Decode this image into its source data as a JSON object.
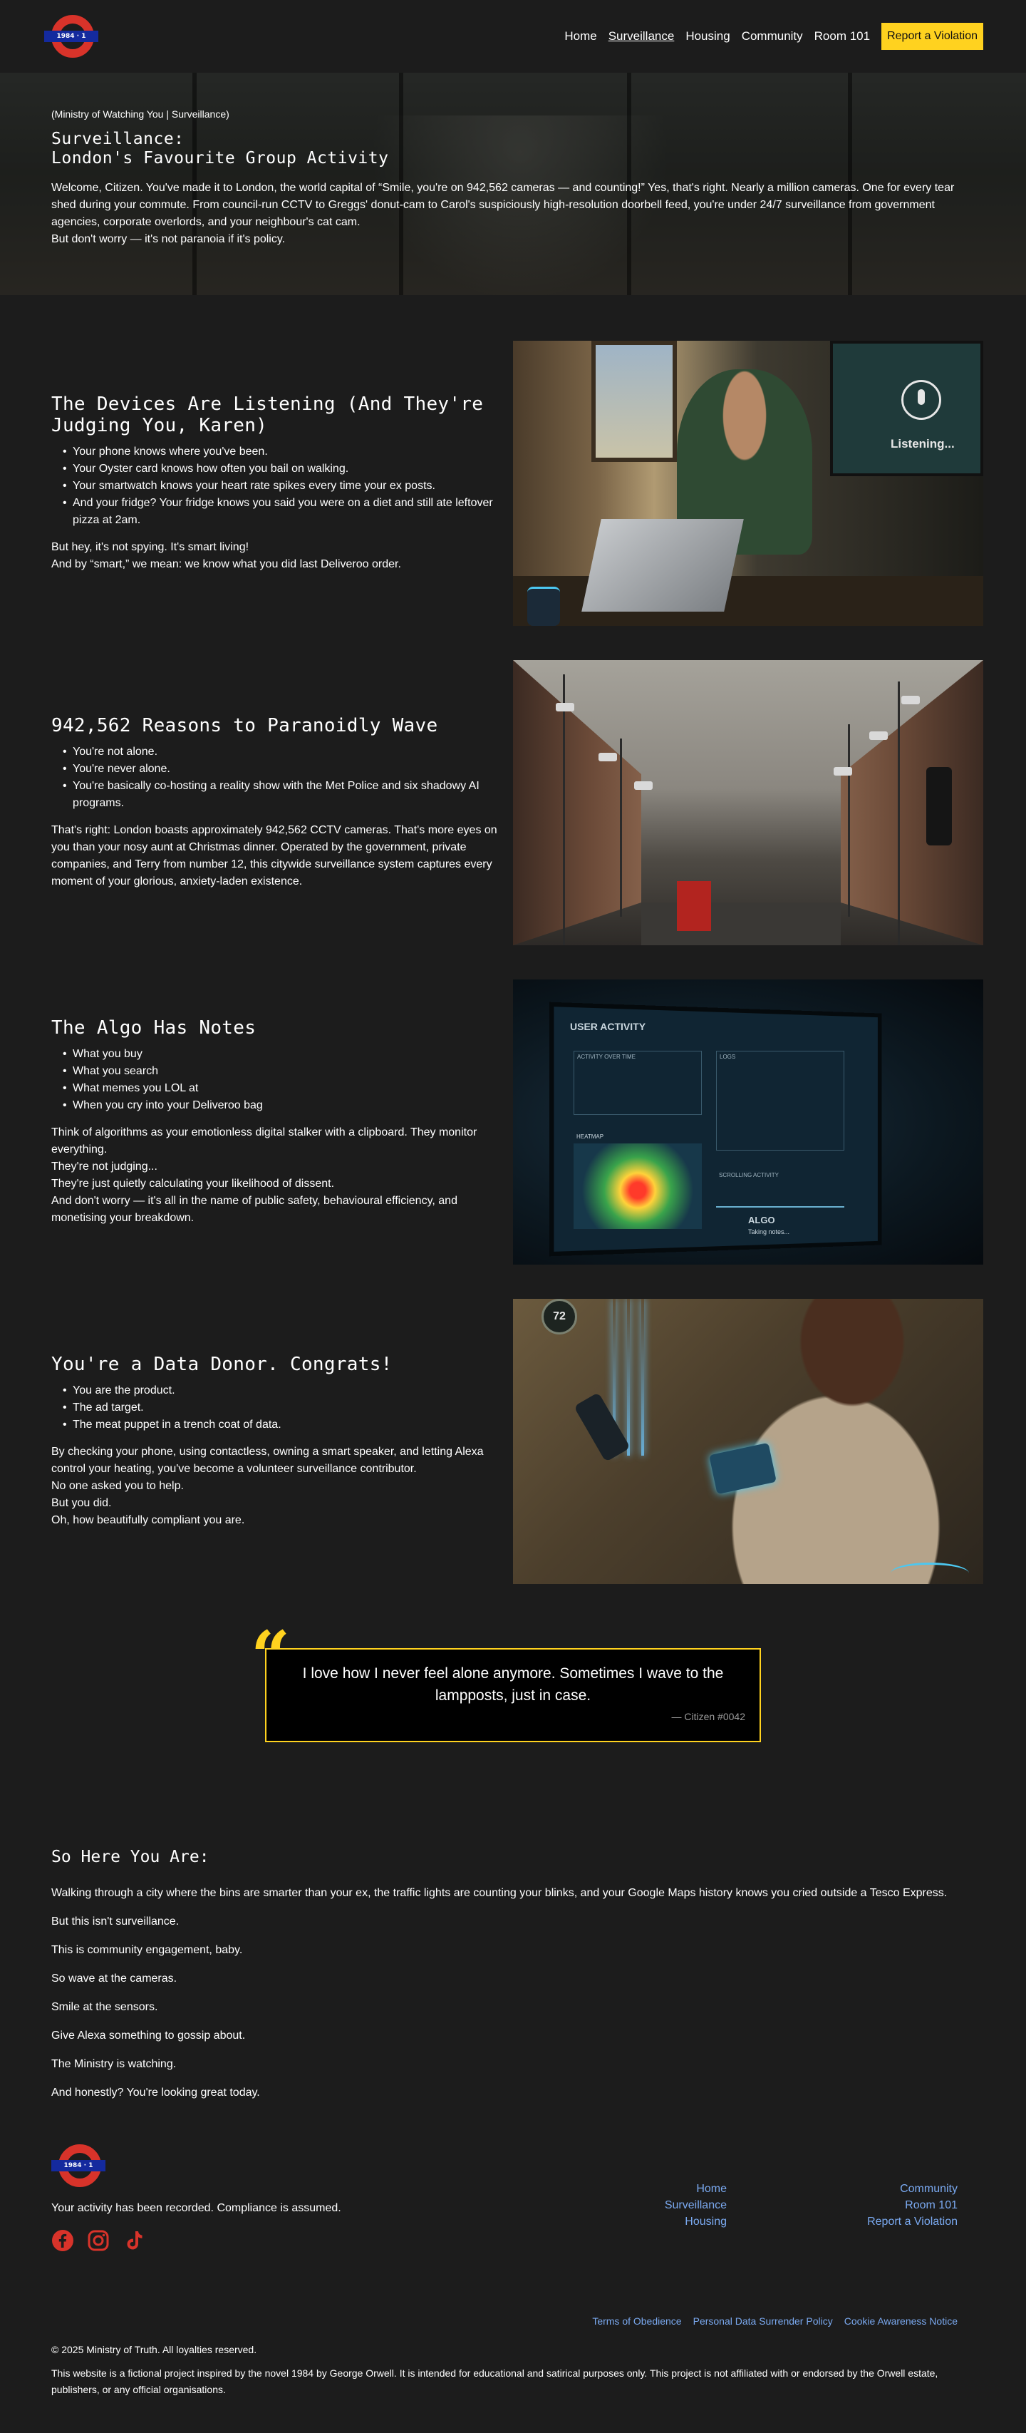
{
  "header": {
    "logo_text": "1984 · 1",
    "nav": [
      {
        "label": "Home"
      },
      {
        "label": "Surveillance"
      },
      {
        "label": "Housing"
      },
      {
        "label": "Community"
      },
      {
        "label": "Room 101"
      }
    ],
    "cta_label": "Report a Violation"
  },
  "hero": {
    "breadcrumb": "(Ministry of Watching You | Surveillance)",
    "title_line1": "Surveillance:",
    "title_line2": "London's Favourite Group Activity",
    "para1": "Welcome, Citizen. You've made it to London, the world capital of “Smile, you're on 942,562 cameras — and counting!” Yes, that's right. Nearly a million cameras. One for every tear shed during your commute. From council-run CCTV to Greggs' donut-cam to Carol's suspiciously high-resolution doorbell feed, you're under 24/7 surveillance from government agencies, corporate overlords, and your neighbour's cat cam.",
    "para2": "But don't worry — it's not paranoia if it's policy."
  },
  "features": [
    {
      "title": "The Devices Are Listening (And They're Judging You, Karen)",
      "bullets": [
        "Your phone knows where you've been.",
        "Your Oyster card knows how often you bail on walking.",
        "Your smartwatch knows your heart rate spikes every time your ex posts.",
        "And your fridge? Your fridge knows you said you were on a diet and still ate leftover pizza at 2am."
      ],
      "body": [
        "But hey, it's not spying. It's smart living!",
        "And by “smart,” we mean: we know what you did last Deliveroo order."
      ],
      "image_label": "Listening..."
    },
    {
      "title": "942,562 Reasons to Paranoidly Wave",
      "bullets": [
        "You're not alone.",
        "You're never alone.",
        "You're basically co-hosting a reality show with the Met Police and six shadowy AI programs."
      ],
      "body": [
        "That's right: London boasts approximately 942,562 CCTV cameras. That's more eyes on you than your nosy aunt at Christmas dinner. Operated by the government, private companies, and Terry from number 12, this citywide surveillance system captures every moment of your glorious, anxiety-laden existence."
      ]
    },
    {
      "title": "The Algo Has Notes",
      "bullets": [
        "What you buy",
        "What you search",
        "What memes you LOL at",
        "When you cry into your Deliveroo bag"
      ],
      "body": [
        "Think of algorithms as your emotionless digital stalker with a clipboard. They monitor everything.",
        "They're not judging...",
        "They're just quietly calculating your likelihood of dissent.",
        "And don't worry — it's all in the name of public safety, behavioural efficiency, and monetising your breakdown."
      ],
      "image_title": "USER ACTIVITY",
      "image_sub1": "ACTIVITY OVER TIME",
      "image_sub2": "HEATMAP",
      "image_sub3": "LOGS",
      "image_sub4": "SCROLLING ACTIVITY",
      "image_sub5": "ALGO",
      "image_sub6": "Taking notes..."
    },
    {
      "title": "You're a Data Donor. Congrats!",
      "bullets": [
        "You are the product.",
        "The ad target.",
        "The meat puppet in a trench coat of data."
      ],
      "body": [
        "By checking your phone, using contactless, owning a smart speaker, and letting Alexa control your heating, you've become a volunteer surveillance contributor.",
        "No one asked you to help.",
        "But you did.",
        "Oh, how beautifully compliant you are."
      ],
      "thermostat": "72"
    }
  ],
  "quote": {
    "mark": "“",
    "text": "I love how I never feel alone anymore. Sometimes I wave to the lampposts, just in case.",
    "cite": "— Citizen #0042"
  },
  "summary": {
    "title": "So Here You Are:",
    "paragraphs": [
      "Walking through a city where the bins are smarter than your ex, the traffic lights are counting your blinks, and your Google Maps history knows you cried outside a Tesco Express.",
      "But this isn't surveillance.",
      "This is community engagement, baby.",
      "So wave at the cameras.",
      "Smile at the sensors.",
      "Give Alexa something to gossip about.",
      "The Ministry is watching.",
      "And honestly? You're looking great today."
    ]
  },
  "footer": {
    "tagline": "Your activity has been recorded. Compliance is assumed.",
    "col1": [
      "Home",
      "Surveillance",
      "Housing"
    ],
    "col2": [
      "Community",
      "Room 101",
      "Report a Violation"
    ],
    "legal": [
      "Terms of Obedience",
      "Personal Data Surrender Policy",
      "Cookie Awareness Notice"
    ],
    "copyright": "© 2025 Ministry of Truth. All loyalties reserved.",
    "disclaimer": "This website is a fictional project inspired by the novel 1984 by George Orwell. It is intended for educational and satirical purposes only. This project is not affiliated with or endorsed by the Orwell estate, publishers, or any official organisations."
  },
  "colors": {
    "accent_yellow": "#ffd21f",
    "logo_red": "#d8332a",
    "logo_blue": "#142a9e",
    "link_blue": "#7aa9f0",
    "background": "#1c1c1c"
  }
}
